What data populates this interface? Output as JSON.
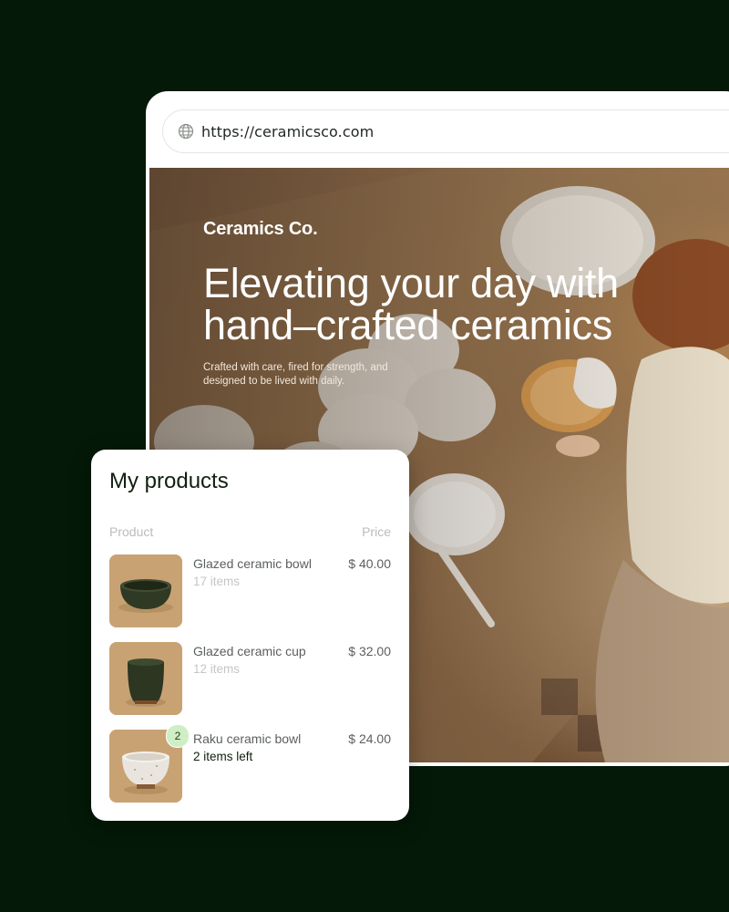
{
  "browser": {
    "url": "https://ceramicsco.com"
  },
  "hero": {
    "brand": "Ceramics Co.",
    "headline": "Elevating your day with hand–crafted ceramics",
    "subhead": "Crafted with care, fired for strength, and designed to be lived with daily."
  },
  "products_card": {
    "title": "My products",
    "columns": {
      "product": "Product",
      "price": "Price"
    },
    "items": [
      {
        "name": "Glazed ceramic bowl",
        "stock": "17 items",
        "price": "$ 40.00",
        "badge": null
      },
      {
        "name": "Glazed ceramic cup",
        "stock": "12 items",
        "price": "$ 32.00",
        "badge": null
      },
      {
        "name": "Raku ceramic bowl",
        "stock": "2 items left",
        "price": "$ 24.00",
        "badge": "2"
      }
    ]
  },
  "icons": {
    "url": "globe-icon"
  },
  "colors": {
    "page_background": "#041907",
    "badge_background": "#cfeec6",
    "heading_text": "#10200f"
  }
}
